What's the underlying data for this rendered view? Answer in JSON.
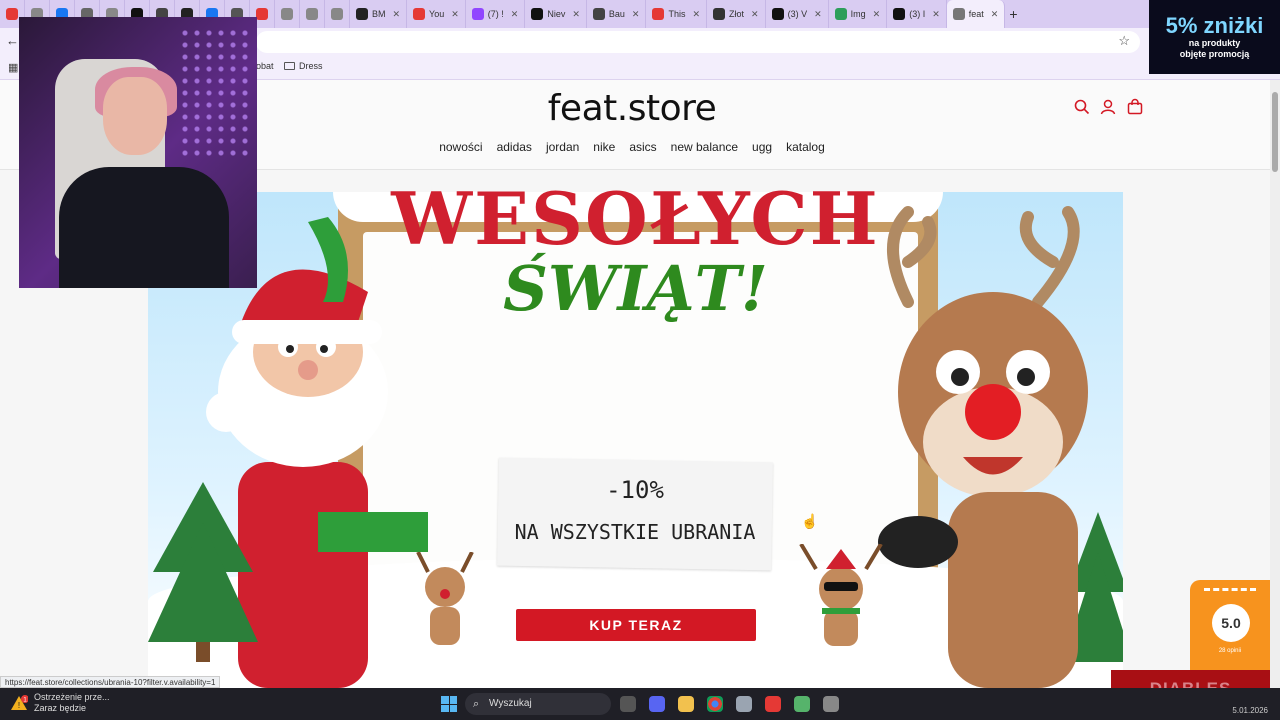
{
  "browser": {
    "tabs": [
      {
        "label": "",
        "color": "#e53935"
      },
      {
        "label": "",
        "color": "#888888"
      },
      {
        "label": "",
        "color": "#1877f2"
      },
      {
        "label": "",
        "color": "#666666"
      },
      {
        "label": "",
        "color": "#888888"
      },
      {
        "label": "",
        "color": "#111111"
      },
      {
        "label": "",
        "color": "#444444"
      },
      {
        "label": "",
        "color": "#222222"
      },
      {
        "label": "",
        "color": "#1877f2"
      },
      {
        "label": "",
        "color": "#555555"
      },
      {
        "label": "",
        "color": "#e53935"
      },
      {
        "label": "",
        "color": "#888888"
      },
      {
        "label": "",
        "color": "#888888"
      },
      {
        "label": "",
        "color": "#888888"
      },
      {
        "label": "BM",
        "color": "#222222"
      },
      {
        "label": "You",
        "color": "#e53935"
      },
      {
        "label": "(7) !",
        "color": "#9146ff"
      },
      {
        "label": "Niev",
        "color": "#111111"
      },
      {
        "label": "Bau",
        "color": "#444444"
      },
      {
        "label": "This",
        "color": "#e53935"
      },
      {
        "label": "Złot",
        "color": "#333333"
      },
      {
        "label": "(3) V",
        "color": "#111111"
      },
      {
        "label": "Img",
        "color": "#2e9e5b"
      },
      {
        "label": "(3) I",
        "color": "#111111"
      },
      {
        "label": "feat",
        "color": "#777777",
        "active": true
      }
    ],
    "new_tab_label": "+",
    "bookmarks": {
      "item1": "obat",
      "item2": "Dress"
    }
  },
  "site": {
    "logo": "feat.store",
    "nav": [
      "nowości",
      "adidas",
      "jordan",
      "nike",
      "asics",
      "new balance",
      "ugg",
      "katalog"
    ],
    "icons": [
      "search-icon",
      "account-icon",
      "cart-icon"
    ],
    "accent_color": "#d31824"
  },
  "banner": {
    "headline": "WESOŁYCH",
    "headline2": "ŚWIĄT!",
    "discount": "-10%",
    "discount_text": "NA WSZYSTKIE UBRANIA",
    "cta_label": "KUP TERAZ"
  },
  "rating_widget": {
    "score": "5.0",
    "count": "28 opinii"
  },
  "status_bar": {
    "url": "https://feat.store/collections/ubrania-10?filter.v.availability=1"
  },
  "promo": {
    "title": "5% zniżki",
    "line1": "na produkty",
    "line2": "objęte promocją"
  },
  "overlay_badge": {
    "label": "DIABLES"
  },
  "taskbar": {
    "notification_title": "Ostrzeżenie prze...",
    "notification_sub": "Zaraz będzie",
    "search_placeholder": "Wyszukaj",
    "notification_badge": "1",
    "clock_date": "5.01.2026"
  }
}
